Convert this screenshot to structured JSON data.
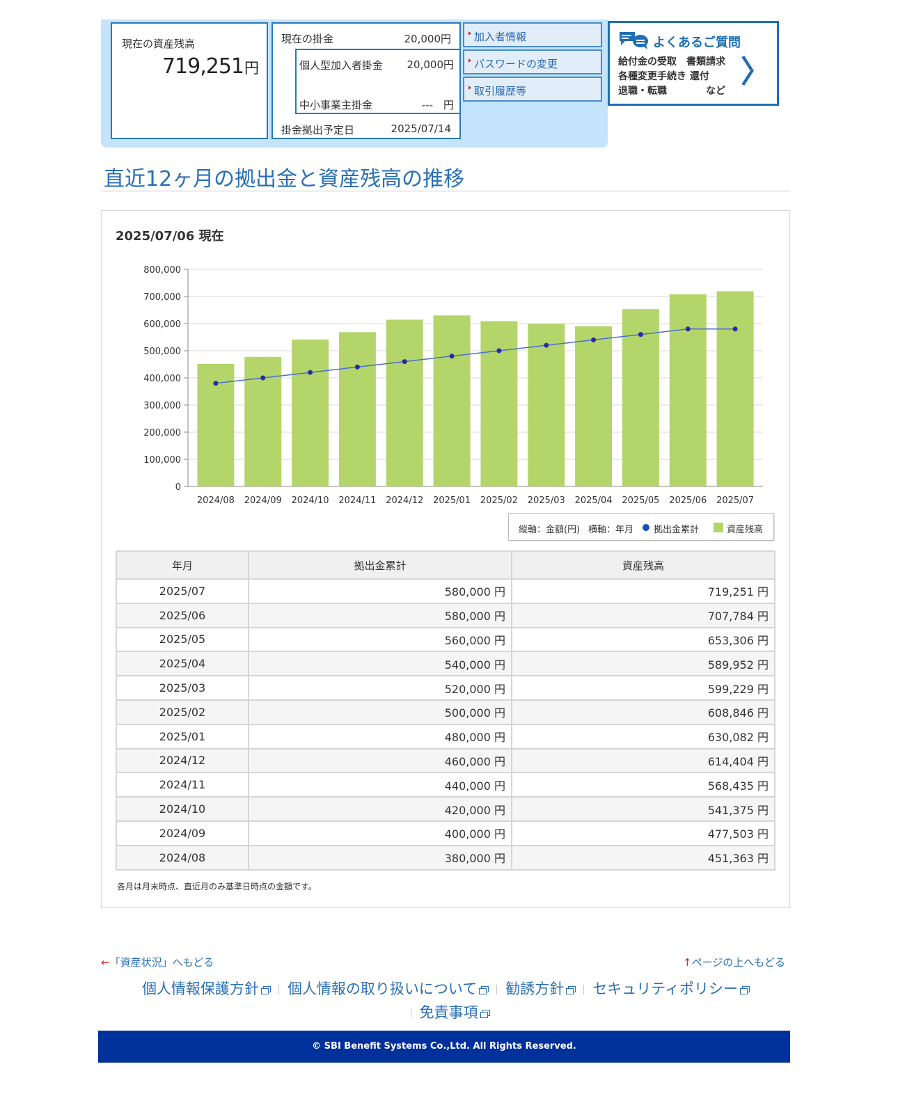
{
  "summary": {
    "balance_label": "現在の資産残高",
    "balance_value": "719,251",
    "balance_unit": "円",
    "contribution_label": "現在の掛金",
    "contribution_value": "20,000円",
    "individual_label": "個人型加入者掛金",
    "individual_value": "20,000円",
    "employer_label": "中小事業主掛金",
    "employer_value": "---　円",
    "schedule_label": "掛金拠出予定日",
    "schedule_value": "2025/07/14"
  },
  "links": {
    "member_info": "加入者情報",
    "password_change": "パスワードの変更",
    "transaction_history": "取引履歴等"
  },
  "faq": {
    "title": "よくあるご質問",
    "line1": "給付金の受取　書類請求",
    "line2": "各種変更手続き 還付",
    "line3": "退職・転職　　　　など"
  },
  "section_title": "直近12ヶ月の拠出金と資産残高の推移",
  "as_of": "2025/07/06 現在",
  "chart_data": {
    "type": "bar",
    "categories": [
      "2024/08",
      "2024/09",
      "2024/10",
      "2024/11",
      "2024/12",
      "2025/01",
      "2025/02",
      "2025/03",
      "2025/04",
      "2025/05",
      "2025/06",
      "2025/07"
    ],
    "series": [
      {
        "name": "資産残高",
        "type": "bar",
        "color": "#b4d56a",
        "values": [
          451363,
          477503,
          541375,
          568435,
          614404,
          630082,
          608846,
          599229,
          589952,
          653306,
          707784,
          719251
        ]
      },
      {
        "name": "拠出金累計",
        "type": "line",
        "color": "#1a4fc0",
        "values": [
          380000,
          400000,
          420000,
          440000,
          460000,
          480000,
          500000,
          520000,
          540000,
          560000,
          580000,
          580000
        ]
      }
    ],
    "yticks": [
      "800,000",
      "700,000",
      "600,000",
      "500,000",
      "400,000",
      "300,000",
      "200,000",
      "100,000",
      "0"
    ],
    "ylim": [
      0,
      800000
    ],
    "grid": true,
    "legend_position": "bottom-right"
  },
  "legend": {
    "yaxis": "縦軸：金額(円)",
    "xaxis": "横軸：年月",
    "contrib": "拠出金累計",
    "asset": "資産残高"
  },
  "table": {
    "headers": [
      "年月",
      "拠出金累計",
      "資産残高"
    ],
    "rows": [
      [
        "2025/07",
        "580,000 円",
        "719,251 円"
      ],
      [
        "2025/06",
        "580,000 円",
        "707,784 円"
      ],
      [
        "2025/05",
        "560,000 円",
        "653,306 円"
      ],
      [
        "2025/04",
        "540,000 円",
        "589,952 円"
      ],
      [
        "2025/03",
        "520,000 円",
        "599,229 円"
      ],
      [
        "2025/02",
        "500,000 円",
        "608,846 円"
      ],
      [
        "2025/01",
        "480,000 円",
        "630,082 円"
      ],
      [
        "2024/12",
        "460,000 円",
        "614,404 円"
      ],
      [
        "2024/11",
        "440,000 円",
        "568,435 円"
      ],
      [
        "2024/10",
        "420,000 円",
        "541,375 円"
      ],
      [
        "2024/09",
        "400,000 円",
        "477,503 円"
      ],
      [
        "2024/08",
        "380,000 円",
        "451,363 円"
      ]
    ]
  },
  "note": "各月は月末時点、直近月のみ基準日時点の金額です。",
  "footer": {
    "back_link": "「資産状況」へもどる",
    "top_link": "ページの上へもどる",
    "privacy_policy": "個人情報保護方針",
    "privacy_handling": "個人情報の取り扱いについて",
    "solicitation": "勧誘方針",
    "security_policy": "セキュリティポリシー",
    "disclaimer": "免責事項",
    "copyright": "© SBI Benefit Systems Co.,Ltd. All Rights Reserved."
  },
  "colors": {
    "accent": "#2a6fb5",
    "panel_bg": "#c3e4fb",
    "footer_bg": "#00309a"
  }
}
